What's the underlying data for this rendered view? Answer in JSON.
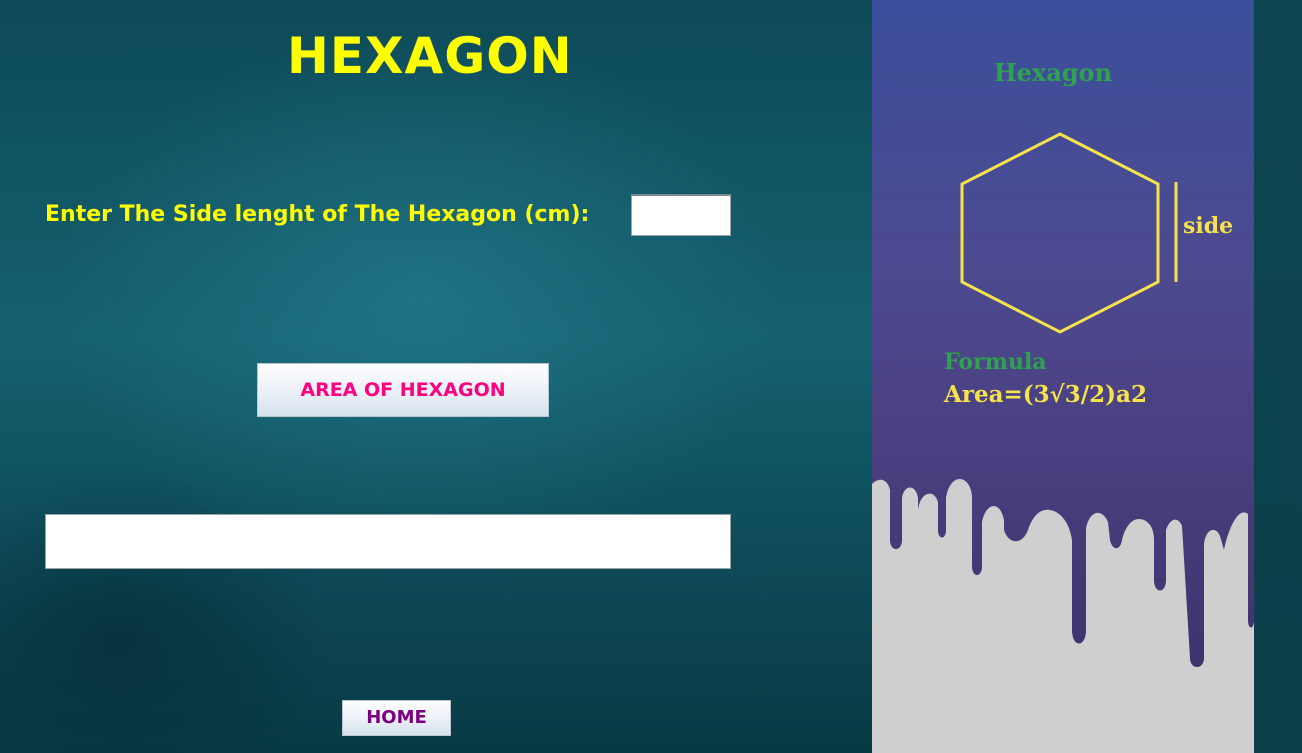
{
  "page": {
    "title": "HEXAGON"
  },
  "form": {
    "side_prompt": "Enter The Side lenght of The Hexagon (cm):",
    "side_value": "",
    "result_value": ""
  },
  "buttons": {
    "area_label": "AREA OF HEXAGON",
    "home_label": "HOME"
  },
  "info_panel": {
    "shape_name": "Hexagon",
    "side_label": "side",
    "formula_heading": "Formula",
    "formula": "Area=(3√3/2)a2"
  },
  "icons": {
    "hexagon": "hexagon-diagram-icon",
    "side_marker": "side-length-bar-icon",
    "paint_drips": "paint-drip-decoration"
  },
  "colors": {
    "title": "#ffff00",
    "prompt": "#ffff00",
    "area_button_text": "#ff0080",
    "home_button_text": "#7a0080",
    "panel_heading": "#2fa24f",
    "hexagon_stroke": "#f6e24a",
    "panel_bg": "#4a4a90",
    "background": "#0f4d5c"
  }
}
